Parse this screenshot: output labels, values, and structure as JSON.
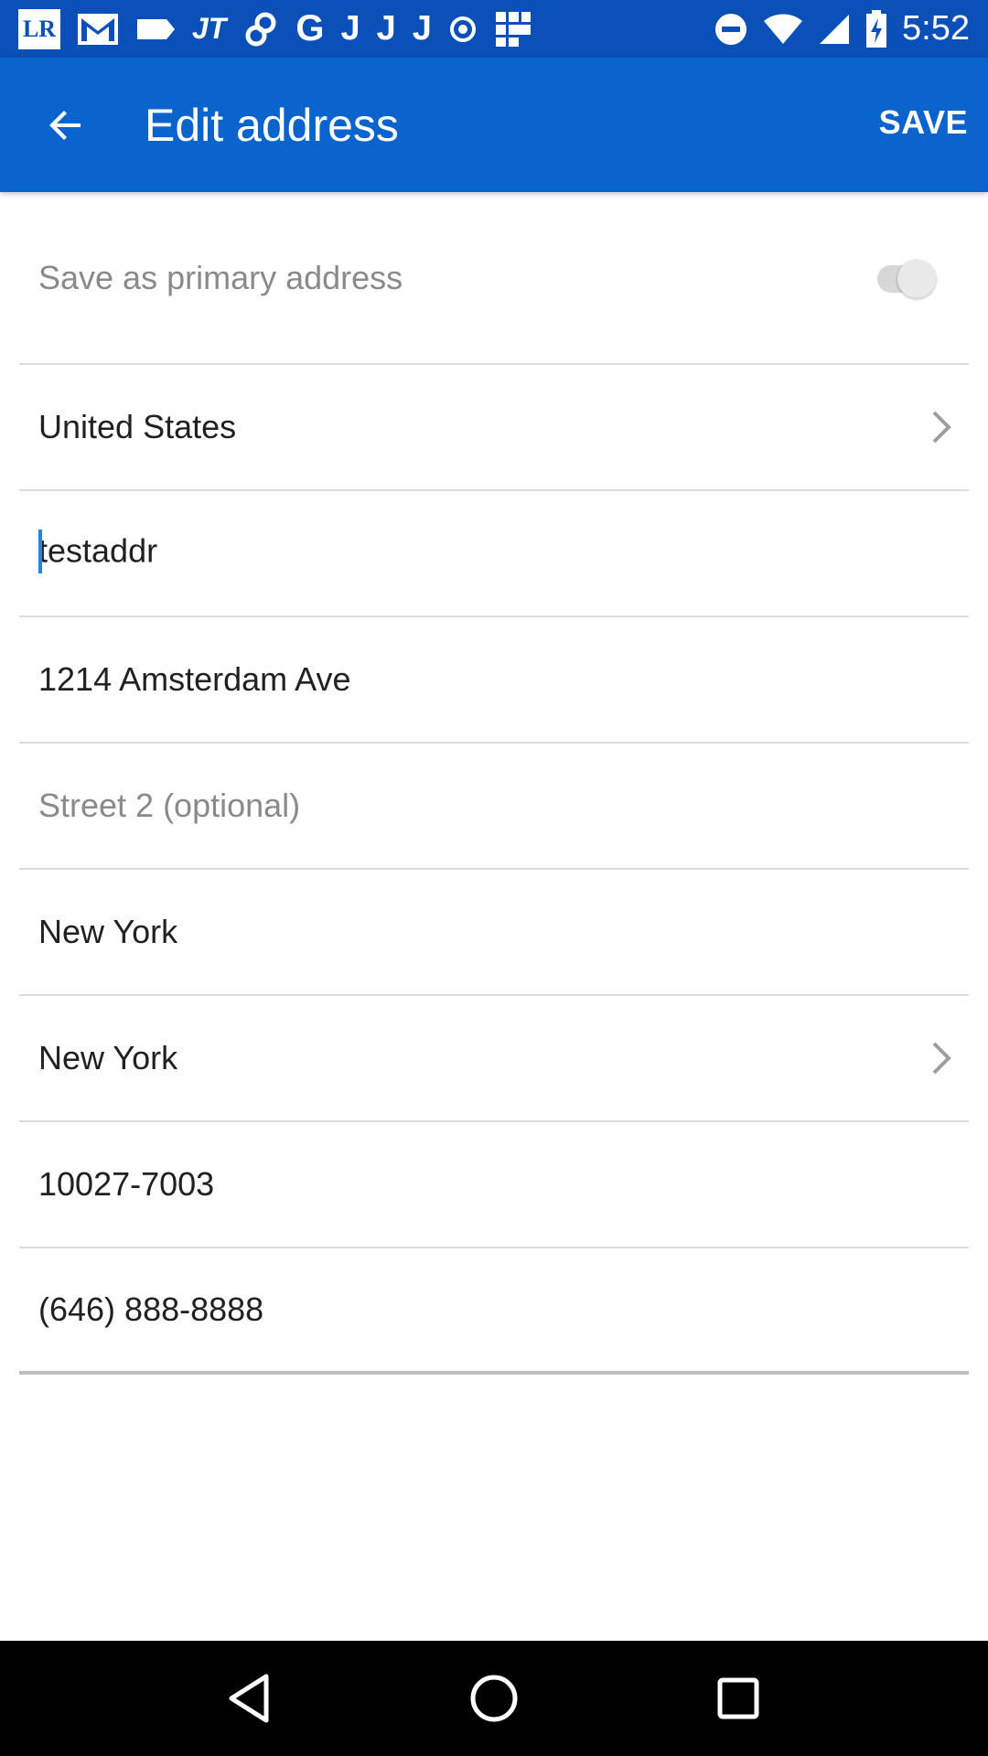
{
  "status_bar": {
    "time": "5:52",
    "left_icons": [
      "lr-icon",
      "gmail-icon",
      "tag-icon",
      "jt-icon",
      "link-icon",
      "google-icon",
      "j-icon",
      "j-icon",
      "j-icon",
      "record-icon",
      "grid-icon"
    ],
    "right_icons": [
      "do-not-disturb-icon",
      "wifi-icon",
      "cell-signal-icon",
      "battery-charging-icon"
    ],
    "lr_text": "LR",
    "jt_text": "JT",
    "g_text": "G",
    "j_text": "J"
  },
  "app_bar": {
    "title": "Edit address",
    "save_label": "SAVE",
    "background": "#0b63cc"
  },
  "form": {
    "primary_toggle_label": "Save as primary address",
    "primary_toggle_on": false,
    "country": "United States",
    "name": "testaddr",
    "street1": "1214 Amsterdam Ave",
    "street2_placeholder": "Street 2 (optional)",
    "city": "New York",
    "state": "New York",
    "zip": "10027-7003",
    "phone": "(646) 888-8888"
  }
}
